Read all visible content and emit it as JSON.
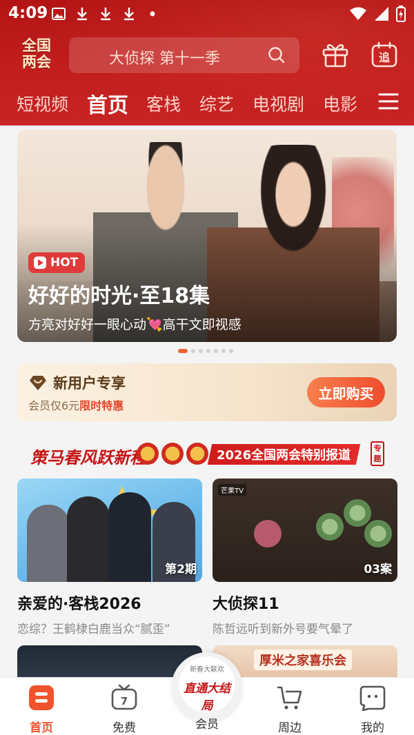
{
  "status_bar": {
    "time": "4:09"
  },
  "header": {
    "logo_line1": "全国",
    "logo_line2": "两会",
    "search_placeholder": "大侦探 第十一季",
    "follow_label": "追"
  },
  "tabs": [
    {
      "label": "短视频"
    },
    {
      "label": "首页"
    },
    {
      "label": "客栈"
    },
    {
      "label": "综艺"
    },
    {
      "label": "电视剧"
    },
    {
      "label": "电影"
    }
  ],
  "banner": {
    "badge": "HOT",
    "title": "好好的时光·至18集",
    "subtitle": "方亮对好好一眼心动💘高干文即视感",
    "page_count": 7,
    "active_index": 0
  },
  "vip": {
    "title": "新用户专享",
    "desc_prefix": "会员仅6元",
    "desc_highlight": "限时特惠",
    "button": "立即购买"
  },
  "special": {
    "slogan": "策马春风跃新程",
    "strip": "2026全国两会特别报道",
    "tag": "专题"
  },
  "cards": [
    {
      "badge": "第2期",
      "title": "亲爱的·客栈2026",
      "subtitle": "恋综？王鹤棣白鹿当众“腻歪”"
    },
    {
      "badge": "03案",
      "source": "芒果TV",
      "title": "大侦探11",
      "subtitle": "陈哲远听到新外号要气晕了"
    }
  ],
  "more_cards": [
    {
      "label": ""
    },
    {
      "label": "厚米之家喜乐会"
    }
  ],
  "bottom_nav": {
    "items": [
      {
        "label": "首页",
        "icon": "home-icon"
      },
      {
        "label": "免费",
        "icon": "tv-icon"
      },
      {
        "label": "会员",
        "icon": "vip-badge"
      },
      {
        "label": "周边",
        "icon": "cart-icon"
      },
      {
        "label": "我的",
        "icon": "profile-icon"
      }
    ],
    "center_top": "新春大联欢",
    "center_text": "直通大结局"
  },
  "colors": {
    "accent": "#f0532c",
    "header_red": "#c21e1e"
  }
}
